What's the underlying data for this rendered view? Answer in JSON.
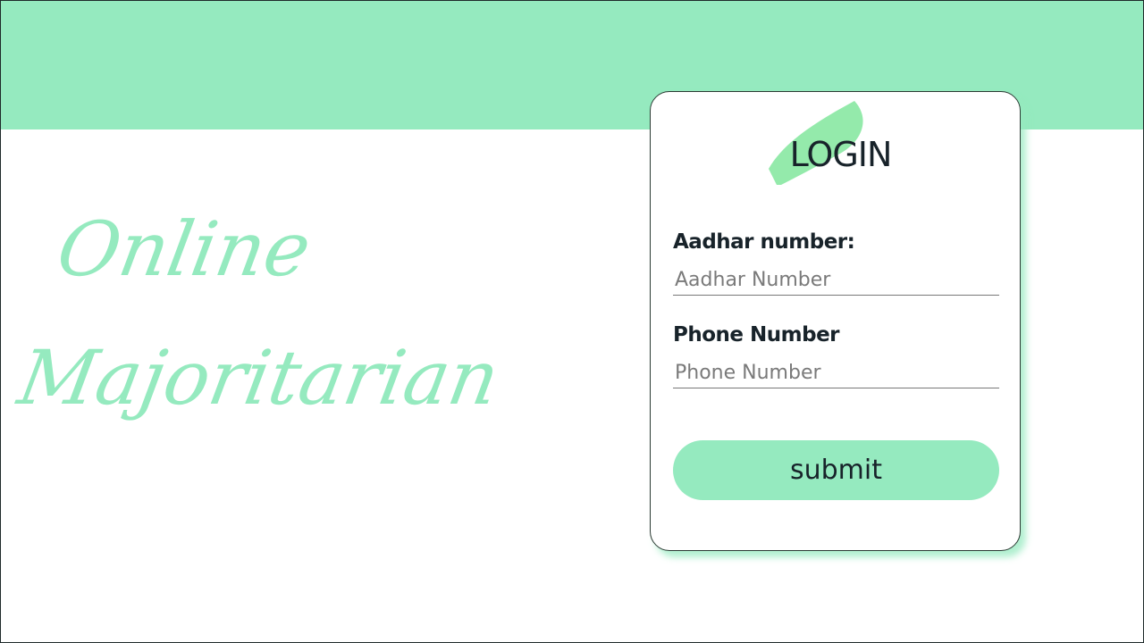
{
  "brand": {
    "line1": "Online",
    "line2": "Majoritarian",
    "color": "#95eabf"
  },
  "theme": {
    "band_color": "#95eabf",
    "accent_color": "#8ee9a7",
    "text_color": "#18232a"
  },
  "login": {
    "title": "LOGIN",
    "aadhar": {
      "label": "Aadhar number:",
      "placeholder": "Aadhar Number",
      "value": ""
    },
    "phone": {
      "label": "Phone Number",
      "placeholder": "Phone Number",
      "value": ""
    },
    "submit_label": "submit"
  }
}
